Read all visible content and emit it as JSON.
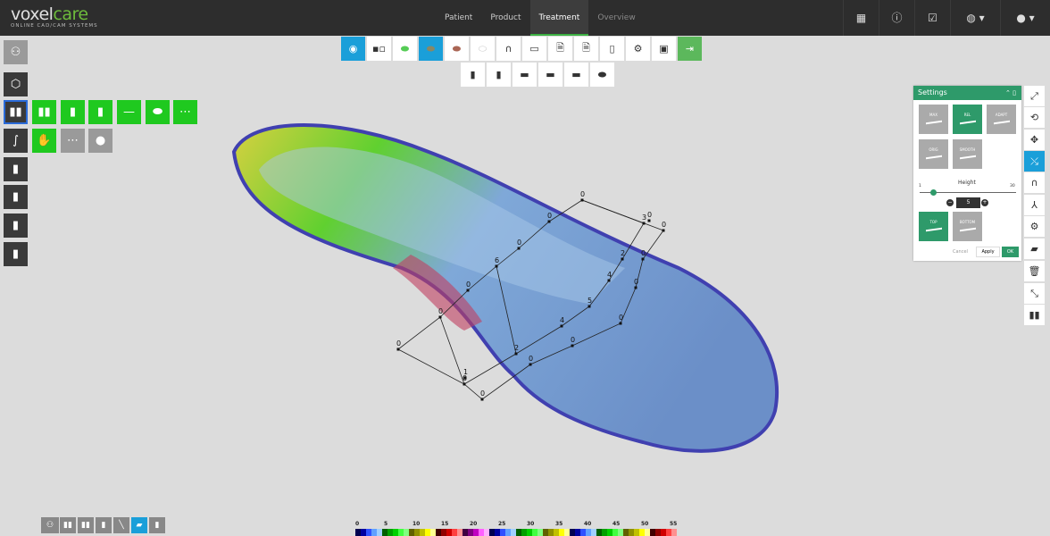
{
  "logo": {
    "name_a": "voxel",
    "name_b": "care",
    "tagline": "ONLINE CAD/CAM SYSTEMS"
  },
  "nav": [
    "Patient",
    "Product",
    "Treatment",
    "Overview"
  ],
  "nav_active": "Treatment",
  "top_icons": [
    "grid-icon",
    "info-icon",
    "checklist-icon",
    "globe-icon",
    "user-icon"
  ],
  "settings": {
    "title": "Settings",
    "modes": [
      "MAX",
      "REL",
      "ADAPT",
      "ORIG",
      "SMOOTH"
    ],
    "active_mode": "REL",
    "slider_label": "Height",
    "slider_min": "1",
    "slider_max": "30",
    "value": "5",
    "slider_fraction": 0.14,
    "sides": [
      "TOP",
      "BOTTOM"
    ],
    "active_side": "TOP",
    "cancel": "Cancel",
    "apply": "Apply",
    "ok": "OK"
  },
  "measure_labels": [
    "0",
    "0",
    "0",
    "6",
    "0",
    "0",
    "0",
    "0",
    "1",
    "0",
    "2",
    "0",
    "4",
    "0",
    "5",
    "0",
    "4",
    "0",
    "2",
    "0",
    "3",
    "0",
    "0"
  ],
  "colorbar": {
    "labels": [
      "0",
      "5",
      "10",
      "15",
      "20",
      "25",
      "30",
      "35",
      "40",
      "45",
      "50",
      "55"
    ],
    "colors": [
      "#000050",
      "#0000a0",
      "#3050ff",
      "#60a0ff",
      "#a0d0ff",
      "#006000",
      "#00a000",
      "#00d000",
      "#40ff40",
      "#80ff80",
      "#606000",
      "#909000",
      "#c0c000",
      "#ffff00",
      "#ffff90",
      "#400000",
      "#900000",
      "#d00000",
      "#ff4040",
      "#ff9090",
      "#400040",
      "#800080",
      "#c000c0",
      "#ff60ff",
      "#ffb0ff",
      "#000050",
      "#0000a0",
      "#3050ff",
      "#60a0ff",
      "#a0d0ff",
      "#006000",
      "#00a000",
      "#00d000",
      "#40ff40",
      "#80ff80",
      "#606000",
      "#909000",
      "#c0c000",
      "#ffff00",
      "#ffff90",
      "#000050",
      "#0000a0",
      "#3050ff",
      "#60a0ff",
      "#a0d0ff",
      "#006000",
      "#00a000",
      "#00d000",
      "#40ff40",
      "#80ff80",
      "#606000",
      "#909000",
      "#c0c000",
      "#ffff00",
      "#ffff90",
      "#400000",
      "#900000",
      "#d00000",
      "#ff4040",
      "#ff9090"
    ]
  }
}
